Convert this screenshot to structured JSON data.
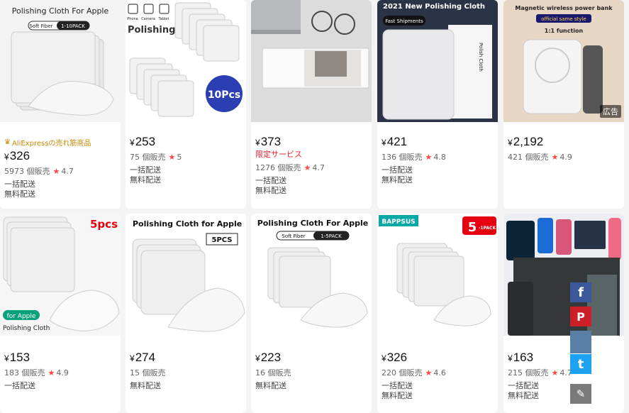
{
  "products": [
    {
      "badge": "AliExpressの売れ筋商品",
      "price": "326",
      "currency": "¥",
      "sold": "5973 個販売",
      "rating": "4.7",
      "shipping": [
        "一括配送",
        "無料配送"
      ],
      "thumb_text": [
        "Polishing Cloth For Apple",
        "Soft Fiber",
        "1-10PACK"
      ]
    },
    {
      "price": "253",
      "currency": "¥",
      "sold": "75 個販売",
      "rating": "5",
      "shipping": [
        "一括配送",
        "無料配送"
      ],
      "thumb_text": [
        "Phone",
        "Camera",
        "Tablet",
        "Polishing",
        "10Pcs"
      ]
    },
    {
      "price": "373",
      "currency": "¥",
      "limited": "限定サービス",
      "sold": "1276 個販売",
      "rating": "4.7",
      "shipping": [
        "一括配送",
        "無料配送"
      ],
      "thumb_text": []
    },
    {
      "price": "421",
      "currency": "¥",
      "sold": "136 個販売",
      "rating": "4.8",
      "shipping": [
        "一括配送",
        "無料配送"
      ],
      "thumb_text": [
        "2021 New Polishing Cloth",
        "Fast Shipments",
        "Polish Cloth"
      ]
    },
    {
      "price": "2,192",
      "currency": "¥",
      "sold": "421 個販売",
      "rating": "4.9",
      "ad": "広告",
      "shipping": [],
      "thumb_text": [
        "Magnetic wireless power bank",
        "official same style",
        "1:1 function"
      ]
    },
    {
      "price": "153",
      "currency": "¥",
      "sold": "183 個販売",
      "rating": "4.9",
      "shipping": [
        "一括配送"
      ],
      "thumb_text": [
        "5pcs",
        "for Apple",
        "Polishing Cloth"
      ]
    },
    {
      "price": "274",
      "currency": "¥",
      "sold": "15 個販売",
      "rating": "",
      "shipping": [
        "無料配送"
      ],
      "thumb_text": [
        "Polishing Cloth for Apple",
        "5PCS"
      ]
    },
    {
      "price": "223",
      "currency": "¥",
      "sold": "16 個販売",
      "rating": "",
      "shipping": [
        "無料配送"
      ],
      "thumb_text": [
        "Polishing Cloth For Apple",
        "Soft Fiber",
        "1-5PACK"
      ]
    },
    {
      "price": "326",
      "currency": "¥",
      "sold": "220 個販売",
      "rating": "4.6",
      "shipping": [
        "一括配送",
        "無料配送"
      ],
      "thumb_text": [
        "BAPPSUS",
        "5",
        "-1PACK"
      ]
    },
    {
      "price": "163",
      "currency": "¥",
      "sold": "215 個販売",
      "rating": "4.7",
      "shipping": [
        "一括配送",
        "無料配送"
      ],
      "thumb_text": []
    }
  ],
  "share": {
    "facebook": "f",
    "pinterest": "P",
    "twitter": "t",
    "edit": "✎"
  },
  "colors": {
    "accent": "#e62e04",
    "star": "#ff4747",
    "facebook": "#3b5998",
    "pinterest": "#cb2027",
    "twitter": "#1da1f2",
    "edit": "#7a7a7a"
  }
}
